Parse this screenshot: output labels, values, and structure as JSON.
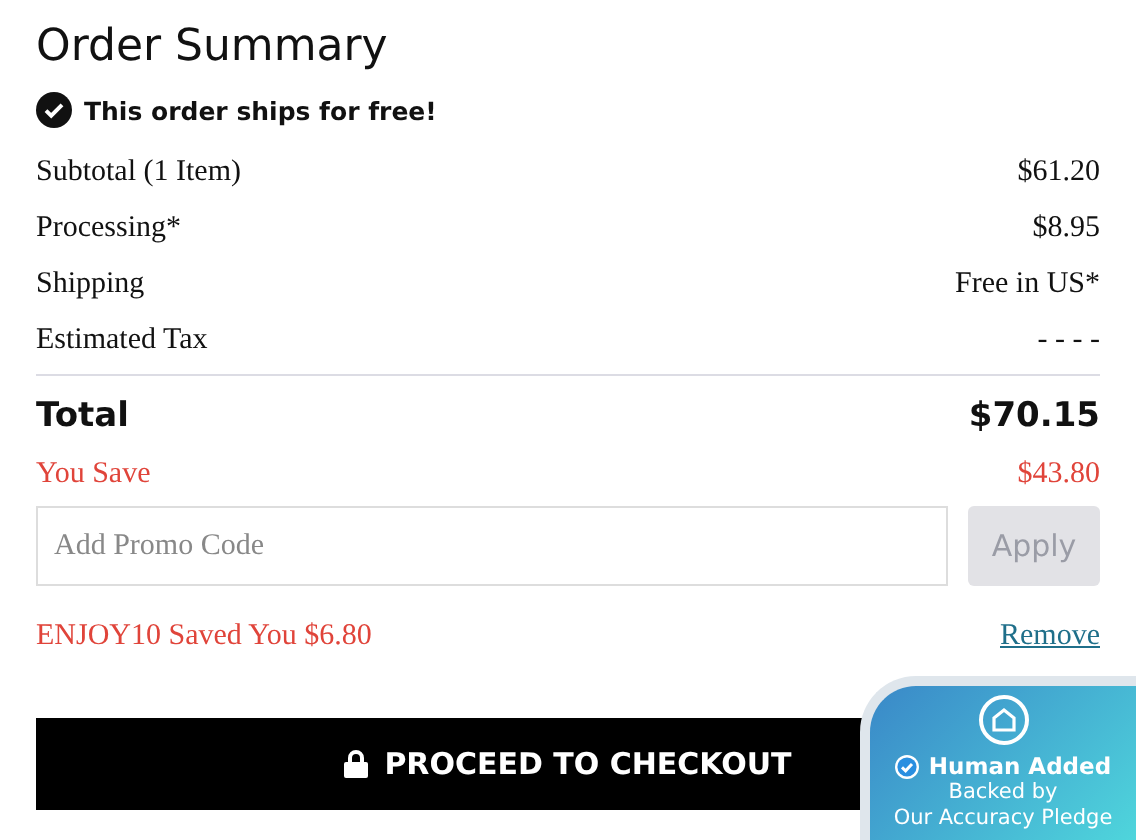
{
  "title": "Order Summary",
  "free_shipping_note": "This order ships for free!",
  "lines": [
    {
      "label": "Subtotal (1 Item)",
      "value": "$61.20"
    },
    {
      "label": "Processing*",
      "value": "$8.95"
    },
    {
      "label": "Shipping",
      "value": "Free in US*"
    },
    {
      "label": "Estimated Tax",
      "value": "- - - -"
    }
  ],
  "total": {
    "label": "Total",
    "value": "$70.15"
  },
  "savings": {
    "label": "You Save",
    "value": "$43.80"
  },
  "promo": {
    "placeholder": "Add Promo Code",
    "button": "Apply",
    "disabled": true
  },
  "applied_promo": {
    "text": "ENJOY10 Saved You $6.80",
    "remove": "Remove"
  },
  "checkout_button": "PROCEED TO CHECKOUT",
  "badge": {
    "title": "Human Added",
    "subtitle": "Backed by",
    "subtitle_2": "Our Accuracy Pledge"
  }
}
